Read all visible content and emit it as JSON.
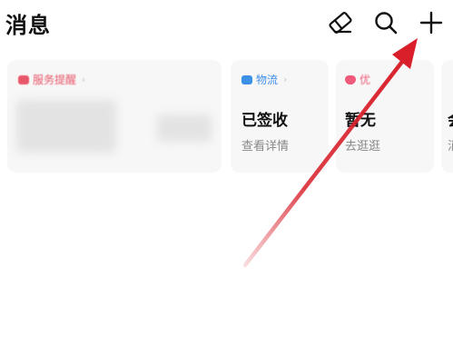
{
  "header": {
    "title": "消息",
    "icons": [
      "eraser-icon",
      "search-icon",
      "plus-icon"
    ]
  },
  "cards": [
    {
      "category": "服务提醒",
      "accent": "#e8566a",
      "blurred": true
    },
    {
      "category": "物流",
      "accent": "#3d8fe8",
      "main": "已签收",
      "sub": "查看详情"
    },
    {
      "category": "优",
      "accent": "#ef5a7a",
      "main": "暂无",
      "sub": "去逛逛"
    },
    {
      "main": "会",
      "sub": "消"
    }
  ],
  "colors": {
    "background": "#ffffff",
    "card_background": "#f7f7f7",
    "annotation_arrow": "#d81f2a"
  }
}
